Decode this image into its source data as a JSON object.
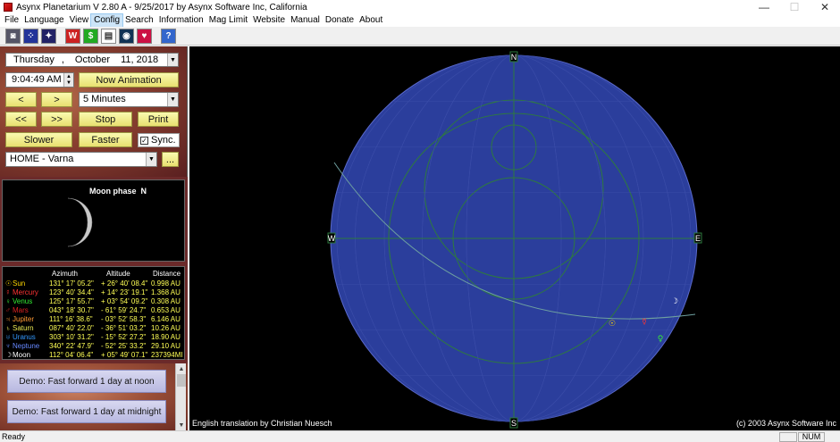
{
  "window": {
    "title": "Asynx Planetarium V 2.80 A - 9/25/2017 by Asynx Software Inc, California",
    "minimize": "—",
    "maximize": "☐",
    "close": "✕"
  },
  "menu": [
    "File",
    "Language",
    "View",
    "Config",
    "Search",
    "Information",
    "Mag Limit",
    "Website",
    "Manual",
    "Donate",
    "About"
  ],
  "menu_active_index": 3,
  "toolbar": {
    "icons": [
      "star-map-icon",
      "constellation-icon",
      "planets-icon",
      "wikipedia-icon",
      "donate-icon",
      "documents-icon",
      "earth-icon",
      "heart-icon",
      "help-icon"
    ],
    "glyphs": [
      "◙",
      "⁘",
      "✦",
      "W",
      "$",
      "▤",
      "◉",
      "♥",
      "?"
    ],
    "colors": [
      "#555566",
      "#223399",
      "#222266",
      "#cc2222",
      "#22aa22",
      "#ffffff",
      "#113355",
      "#cc1144",
      "#3366cc"
    ]
  },
  "controls": {
    "date_day": "Thursday",
    "date_comma": ",",
    "date_month": "October",
    "date_daynum": "11, 2018",
    "time": "9:04:49 AM",
    "now_animation": "Now Animation",
    "step_back": "<",
    "step_forward": ">",
    "interval": "5 Minutes",
    "fast_back": "<<",
    "fast_forward": ">>",
    "stop": "Stop",
    "print": "Print",
    "slower": "Slower",
    "faster": "Faster",
    "sync_label": "Sync.",
    "sync_checked": "✓",
    "location": "HOME - Varna",
    "more": "..."
  },
  "moon_panel": {
    "title": "Moon phase",
    "direction": "N"
  },
  "planet_table": {
    "headers": [
      "Azimuth",
      "Altitude",
      "Distance"
    ],
    "rows": [
      {
        "symbol": "☉",
        "name": "Sun",
        "az": "131° 17' 05.2\"",
        "alt": "+ 26° 40' 08.4\"",
        "dist": "0.998 AU",
        "color": "#ffd700"
      },
      {
        "symbol": "☿",
        "name": "Mercury",
        "az": "123° 40' 34.4\"",
        "alt": "+ 14° 23' 19.1\"",
        "dist": "1.368 AU",
        "color": "#ff3333"
      },
      {
        "symbol": "♀",
        "name": "Venus",
        "az": "125° 17' 55.7\"",
        "alt": "+ 03° 54' 09.2\"",
        "dist": "0.308 AU",
        "color": "#33ee33"
      },
      {
        "symbol": "♂",
        "name": "Mars",
        "az": "043° 18' 30.7\"",
        "alt": "- 61° 59' 24.7\"",
        "dist": "0.653 AU",
        "color": "#dd2222"
      },
      {
        "symbol": "♃",
        "name": "Jupiter",
        "az": "111° 16' 38.6\"",
        "alt": "- 03° 52' 58.3\"",
        "dist": "6.146 AU",
        "color": "#ff9933"
      },
      {
        "symbol": "♄",
        "name": "Saturn",
        "az": "087° 40' 22.0\"",
        "alt": "- 36° 51' 03.2\"",
        "dist": "10.26 AU",
        "color": "#eeee55"
      },
      {
        "symbol": "♅",
        "name": "Uranus",
        "az": "303° 10' 31.2\"",
        "alt": "- 15° 52' 27.2\"",
        "dist": "18.90 AU",
        "color": "#3399ff"
      },
      {
        "symbol": "♆",
        "name": "Neptune",
        "az": "340° 22' 47.9\"",
        "alt": "- 52° 25' 33.2\"",
        "dist": "29.10 AU",
        "color": "#6688ff"
      },
      {
        "symbol": "☽",
        "name": "Moon",
        "az": "112° 04' 06.4\"",
        "alt": "+ 05° 49' 07.1\"",
        "dist": "237394MI",
        "color": "#ffffff"
      }
    ]
  },
  "demos": [
    "Demo: Fast forward 1 day at noon",
    "Demo: Fast forward 1 day at midnight"
  ],
  "sky": {
    "dir_n": "N",
    "dir_s": "S",
    "dir_e": "E",
    "dir_w": "W",
    "credit_left": "English translation by Christian Nuesch",
    "credit_right": "(c) 2003 Asynx Software Inc",
    "sky_color": "#2b3e9c",
    "grid_color": "#2e7a3e"
  },
  "status": {
    "left": "Ready",
    "num": "NUM"
  }
}
